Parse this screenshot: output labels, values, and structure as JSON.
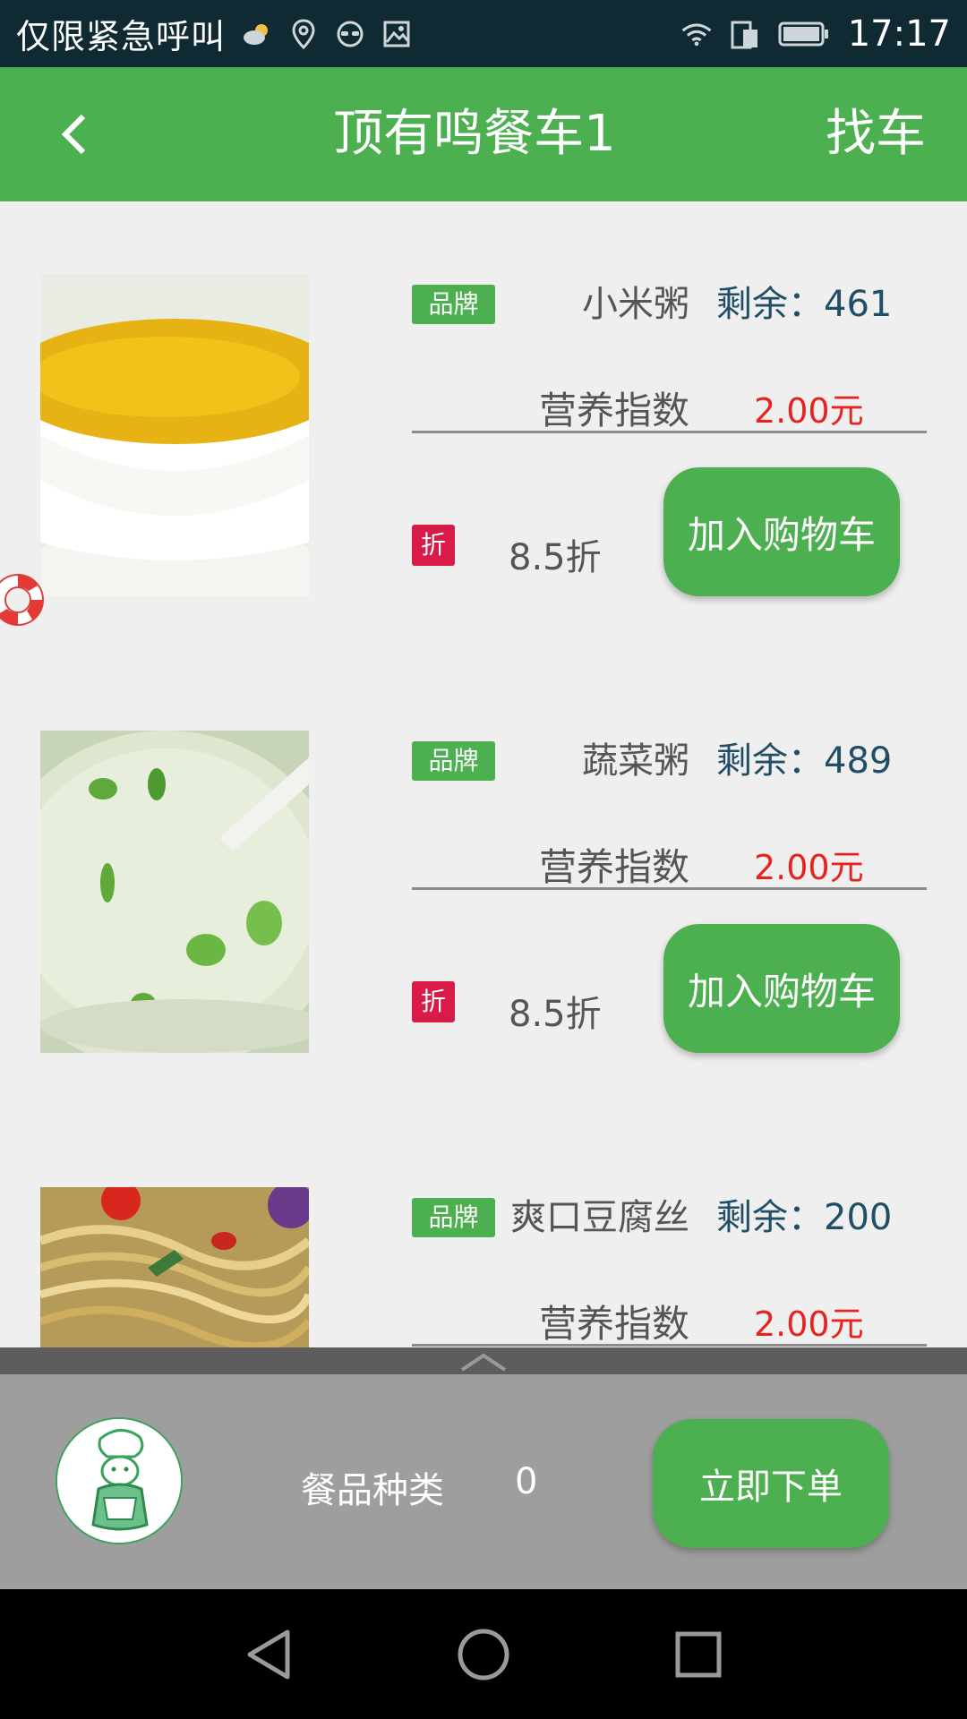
{
  "status_bar": {
    "carrier": "仅限紧急呼叫",
    "time": "17:17",
    "icons": [
      "weather-cloud-icon",
      "location-pin-icon",
      "incognito-icon",
      "image-icon",
      "wifi-icon",
      "sim-icon",
      "battery-icon"
    ]
  },
  "app_bar": {
    "title": "顶有鸣餐车1",
    "action": "找车",
    "back_icon": "back-chevron-icon"
  },
  "items": [
    {
      "brand_tag": "品牌",
      "name": "小米粥",
      "remain": "剩余：461",
      "nutrition_label": "营养指数",
      "price": "2.00元",
      "discount_tag": "折",
      "discount": "8.5折",
      "add_button": "加入购物车"
    },
    {
      "brand_tag": "品牌",
      "name": "蔬菜粥",
      "remain": "剩余：489",
      "nutrition_label": "营养指数",
      "price": "2.00元",
      "discount_tag": "折",
      "discount": "8.5折",
      "add_button": "加入购物车"
    },
    {
      "brand_tag": "品牌",
      "name": "爽口豆腐丝",
      "remain": "剩余：200",
      "nutrition_label": "营养指数",
      "price": "2.00元"
    }
  ],
  "cart": {
    "kind_label": "餐品种类",
    "kind_count": "0",
    "order_button": "立即下单"
  },
  "colors": {
    "primary_green": "#4caf50",
    "price_red": "#e52420",
    "discount_tag": "#d81b47",
    "remain_blue": "#1f4e66"
  }
}
